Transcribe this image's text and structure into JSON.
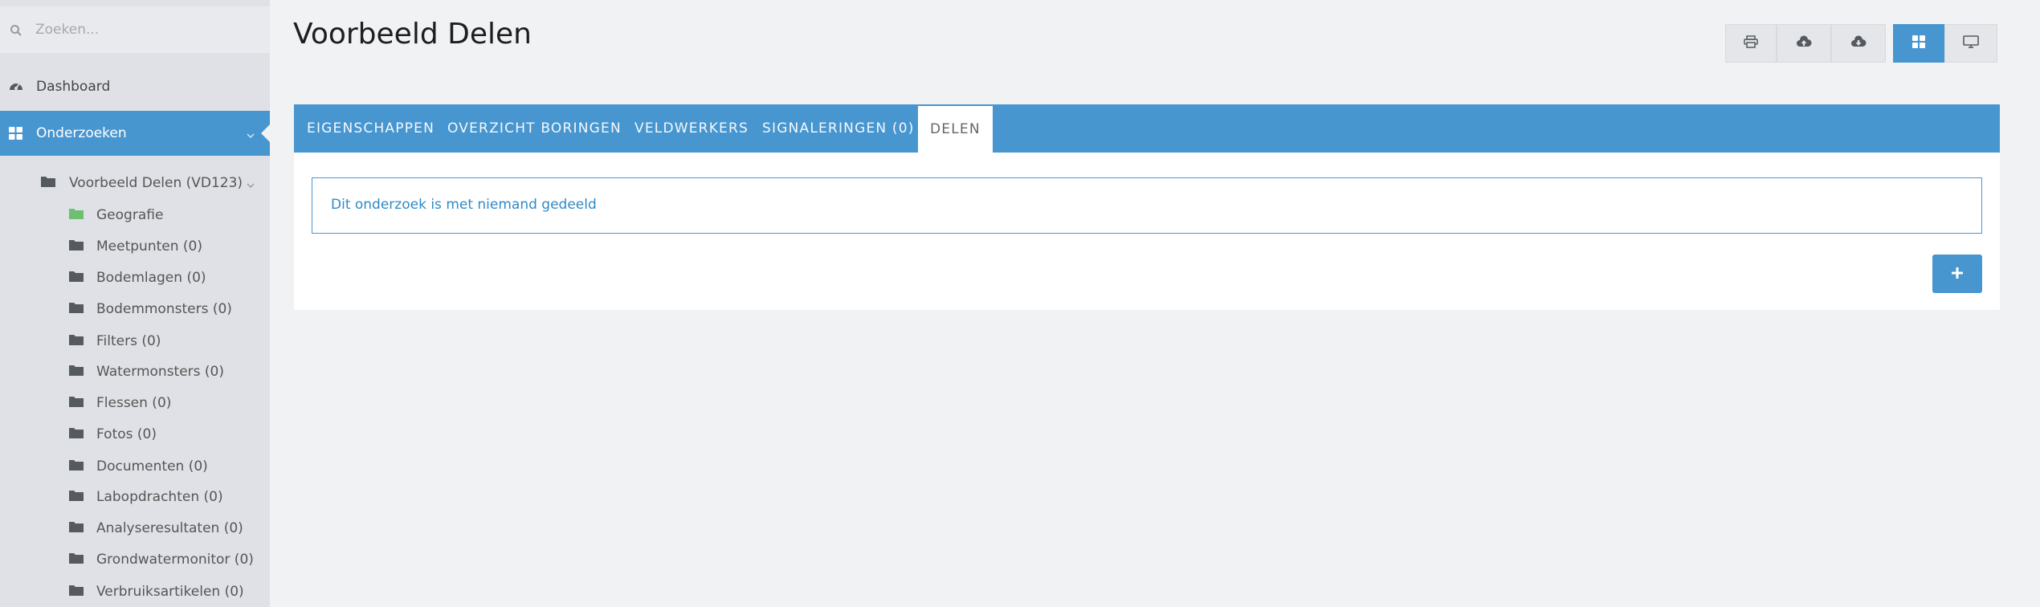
{
  "search": {
    "placeholder": "Zoeken..."
  },
  "sidebar": {
    "dashboard_label": "Dashboard",
    "onderzoeken_label": "Onderzoeken",
    "tree_root_label": "Voorbeeld Delen (VD123)",
    "tree_items": [
      {
        "label": "Geografie",
        "color": "#6cc070"
      },
      {
        "label": "Meetpunten (0)",
        "color": "#555a60"
      },
      {
        "label": "Bodemlagen (0)",
        "color": "#555a60"
      },
      {
        "label": "Bodemmonsters (0)",
        "color": "#555a60"
      },
      {
        "label": "Filters (0)",
        "color": "#555a60"
      },
      {
        "label": "Watermonsters (0)",
        "color": "#555a60"
      },
      {
        "label": "Flessen (0)",
        "color": "#555a60"
      },
      {
        "label": "Fotos (0)",
        "color": "#555a60"
      },
      {
        "label": "Documenten (0)",
        "color": "#555a60"
      },
      {
        "label": "Labopdrachten (0)",
        "color": "#555a60"
      },
      {
        "label": "Analyseresultaten (0)",
        "color": "#555a60"
      },
      {
        "label": "Grondwatermonitor (0)",
        "color": "#555a60"
      },
      {
        "label": "Verbruiksartikelen (0)",
        "color": "#555a60"
      }
    ]
  },
  "page": {
    "title": "Voorbeeld Delen"
  },
  "toolbar": {
    "buttons": [
      "print-icon",
      "cloud-upload-icon",
      "cloud-download-icon",
      "grid-view-icon",
      "monitor-icon"
    ]
  },
  "tabs": [
    {
      "label": "EIGENSCHAPPEN",
      "active": false
    },
    {
      "label": "OVERZICHT BORINGEN",
      "active": false
    },
    {
      "label": "VELDWERKERS",
      "active": false
    },
    {
      "label": "SIGNALERINGEN (0)",
      "active": false
    },
    {
      "label": "DELEN",
      "active": true
    }
  ],
  "share": {
    "message": "Dit onderzoek is met niemand gedeeld",
    "add_label": "+"
  },
  "colors": {
    "accent": "#4896cf",
    "sidebar": "#dfe1e6",
    "background": "#f1f2f4",
    "folder_active": "#6cc070"
  }
}
